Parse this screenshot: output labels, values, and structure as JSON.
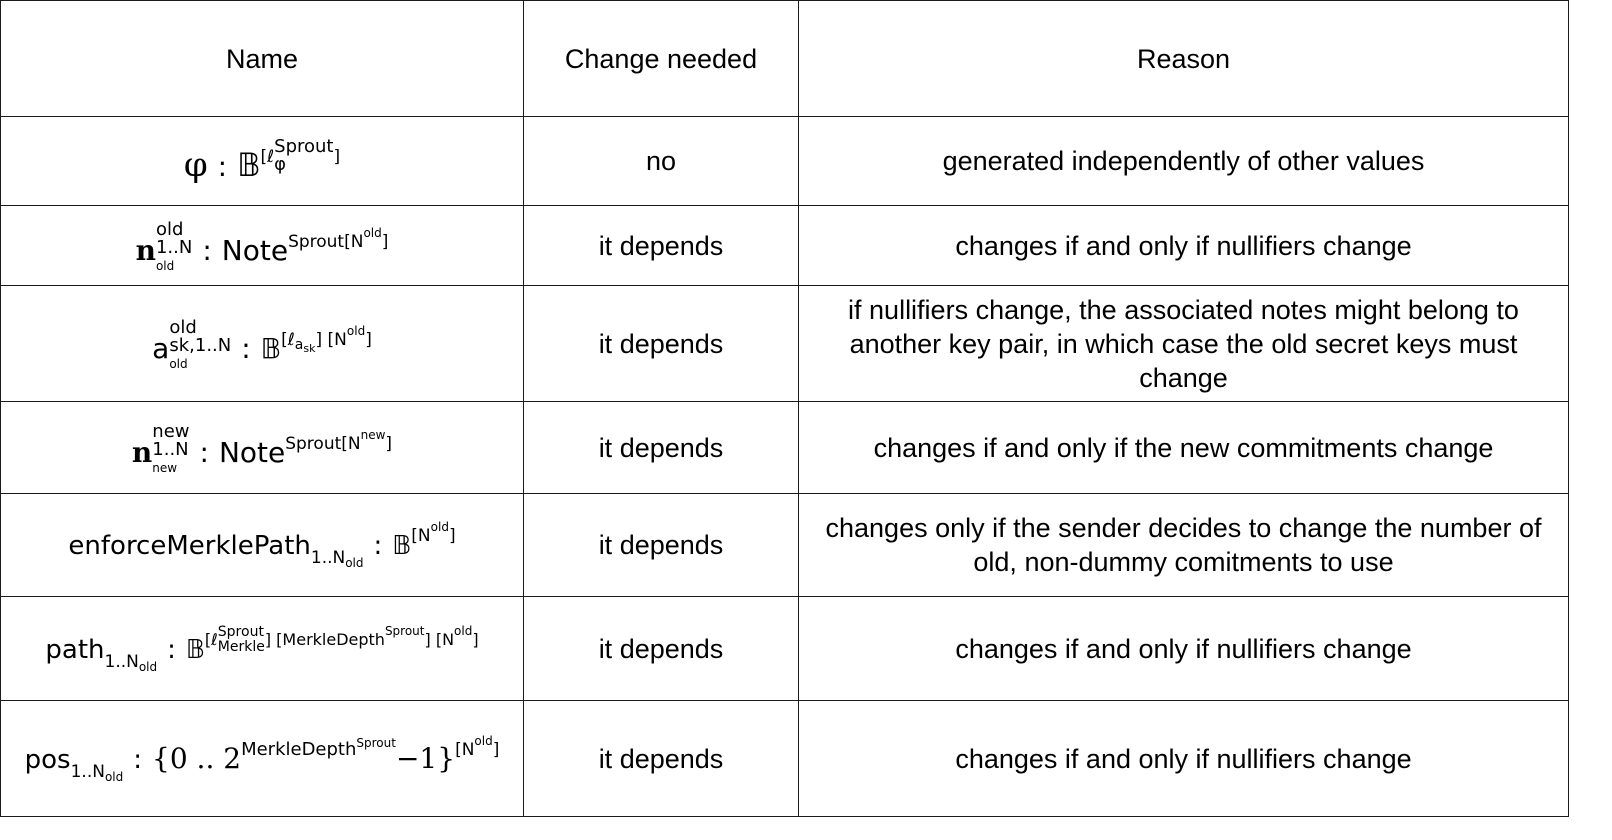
{
  "headers": {
    "name": "Name",
    "change": "Change needed",
    "reason": "Reason"
  },
  "rows": [
    {
      "name": {
        "sym": "φ",
        "colon": ":",
        "type": "𝔹",
        "sup_l": "[ℓ",
        "sup_sub": "φ",
        "sup_top": "Sprout",
        "sup_r": "]"
      },
      "change": "no",
      "reason": "generated independently of other values"
    },
    {
      "name": {
        "sym": "n",
        "top": "old",
        "sub": "1..N",
        "subsup": "old",
        "colon": ":",
        "type": "Note",
        "sup": "Sprout[N",
        "sup2": "old",
        "sup3": "]"
      },
      "change": "it depends",
      "reason": "changes if and only if nullifiers change"
    },
    {
      "name": {
        "sym": "a",
        "top": "old",
        "sub": "sk,1..N",
        "subsup": "old",
        "colon": ":",
        "type": "𝔹",
        "sup": "[ℓ",
        "sup_sub": "a",
        "sup_subsub": "sk",
        "sup_mid": "] [N",
        "sup2": "old",
        "sup3": "]"
      },
      "change": "it depends",
      "reason": "if nullifiers change, the associated notes might belong to another key pair, in which case the old secret keys must change"
    },
    {
      "name": {
        "sym": "n",
        "top": "new",
        "sub": "1..N",
        "subsup": "new",
        "colon": ":",
        "type": "Note",
        "sup": "Sprout[N",
        "sup2": "new",
        "sup3": "]"
      },
      "change": "it depends",
      "reason": "changes if and only if the new commitments change"
    },
    {
      "name": {
        "sym": "enforceMerklePath",
        "sub": "1..N",
        "subsup": "old",
        "colon": ":",
        "type": "𝔹",
        "sup": "[N",
        "sup2": "old",
        "sup3": "]"
      },
      "change": "it depends",
      "reason": "changes only if the sender decides to change the number of old, non-dummy comitments to use"
    },
    {
      "name": {
        "sym": "path",
        "sub": "1..N",
        "subsup": "old",
        "colon": ":",
        "type": "𝔹",
        "sup_l": "[ℓ",
        "stack_top": "Sprout",
        "stack_bot": "Merkle",
        "sup_mid": "] [MerkleDepth",
        "sup_sprout": "Sprout",
        "sup_mid2": "] [N",
        "sup2": "old",
        "sup3": "]"
      },
      "change": "it depends",
      "reason": "changes if and only if nullifiers change"
    },
    {
      "name": {
        "sym": "pos",
        "sub": "1..N",
        "subsup": "old",
        "colon": ":",
        "type_l": "{0 .. 2",
        "exp": "MerkleDepth",
        "exp_sup": "Sprout",
        "type_r": "−1}",
        "sup": "[N",
        "sup2": "old",
        "sup3": "]"
      },
      "change": "it depends",
      "reason": "changes if and only if nullifiers change"
    }
  ]
}
